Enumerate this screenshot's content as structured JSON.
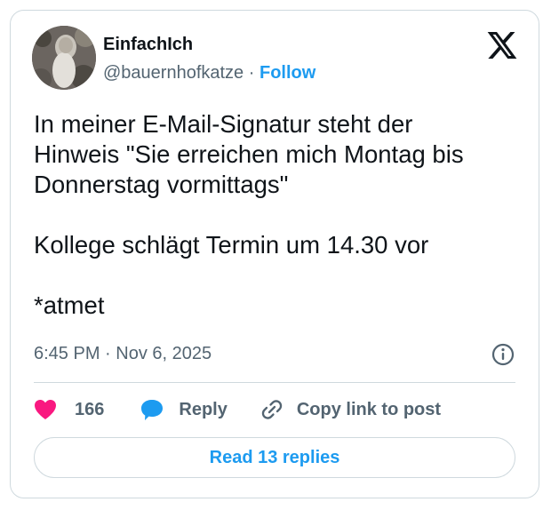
{
  "author": {
    "display_name": "EinfachIch",
    "handle": "@bauernhofkatze",
    "separator": "·",
    "follow_label": "Follow"
  },
  "tweet": {
    "text": "In meiner E-Mail-Signatur steht der\nHinweis \"Sie erreichen mich Montag bis\nDonnerstag vormittags\"\n\nKollege schlägt Termin um 14.30 vor\n\n*atmet",
    "time": "6:45 PM",
    "separator": "·",
    "date": "Nov 6, 2025"
  },
  "actions": {
    "likes_count": "166",
    "reply_label": "Reply",
    "copy_link_label": "Copy link to post"
  },
  "read_replies_label": "Read 13 replies",
  "icons": {
    "logo": "x-logo-icon",
    "info": "info-icon",
    "like": "heart-icon",
    "reply": "speech-bubble-icon",
    "copy": "link-icon"
  },
  "colors": {
    "accent": "#1d9bf0",
    "heart": "#f91880",
    "text": "#0f1419",
    "secondary_text": "#536471",
    "border": "#cfd9de"
  }
}
